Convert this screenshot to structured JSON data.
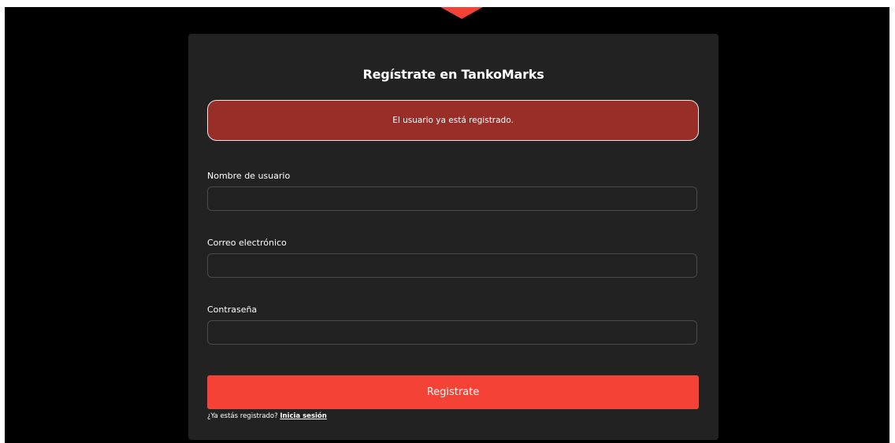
{
  "register_form": {
    "title": "Regístrate en TankoMarks",
    "alert_message": "El usuario ya está registrado.",
    "fields": {
      "username": {
        "label": "Nombre de usuario",
        "value": ""
      },
      "email": {
        "label": "Correo electrónico",
        "value": ""
      },
      "password": {
        "label": "Contraseña",
        "value": ""
      }
    },
    "submit_label": "Registrate",
    "login_prompt": "¿Ya estás registrado?",
    "login_link": "Inicia sesión"
  },
  "colors": {
    "page_background": "#000000",
    "card_background": "#222222",
    "accent": "#f44336",
    "alert_background": "#992d27",
    "input_border": "#4a4a4a"
  },
  "icons": {
    "brand_marker": "triangle-down-icon"
  }
}
